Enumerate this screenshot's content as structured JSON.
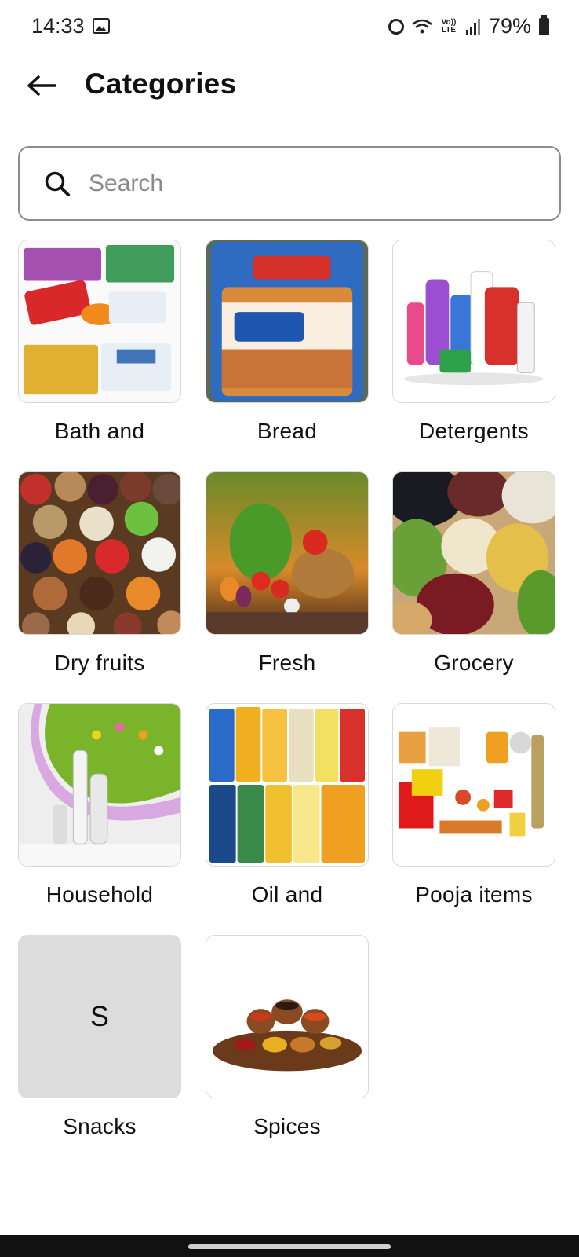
{
  "status_bar": {
    "time": "14:33",
    "lte_label_top": "Vo))",
    "lte_label_bottom": "LTE",
    "battery": "79%",
    "icons": [
      "gallery-icon",
      "alarm-icon",
      "wifi-icon",
      "lte-icon",
      "signal-icon",
      "battery-icon"
    ]
  },
  "header": {
    "title": "Categories",
    "back_icon": "arrow-left-icon"
  },
  "search": {
    "placeholder": "Search",
    "value": ""
  },
  "categories": [
    {
      "label": "Bath and",
      "image": "bath-products-photo"
    },
    {
      "label": "Bread",
      "image": "bread-photo"
    },
    {
      "label": "Detergents",
      "image": "detergents-photo"
    },
    {
      "label": "Dry fruits",
      "image": "dry-fruits-photo"
    },
    {
      "label": "Fresh",
      "image": "fresh-vegetables-photo"
    },
    {
      "label": "Grocery",
      "image": "grocery-grains-photo"
    },
    {
      "label": "Household",
      "image": "household-air-freshener-photo"
    },
    {
      "label": "Oil and",
      "image": "cooking-oil-packs-photo"
    },
    {
      "label": "Pooja items",
      "image": "pooja-items-photo"
    },
    {
      "label": "Snacks",
      "image": "letter-placeholder",
      "placeholder_letter": "S"
    },
    {
      "label": "Spices",
      "image": "spices-photo"
    }
  ],
  "colors": {
    "background": "#ffffff",
    "search_border": "#8c8c8c",
    "placeholder_tile": "#dcdcdc",
    "nav_bar": "#111111"
  }
}
